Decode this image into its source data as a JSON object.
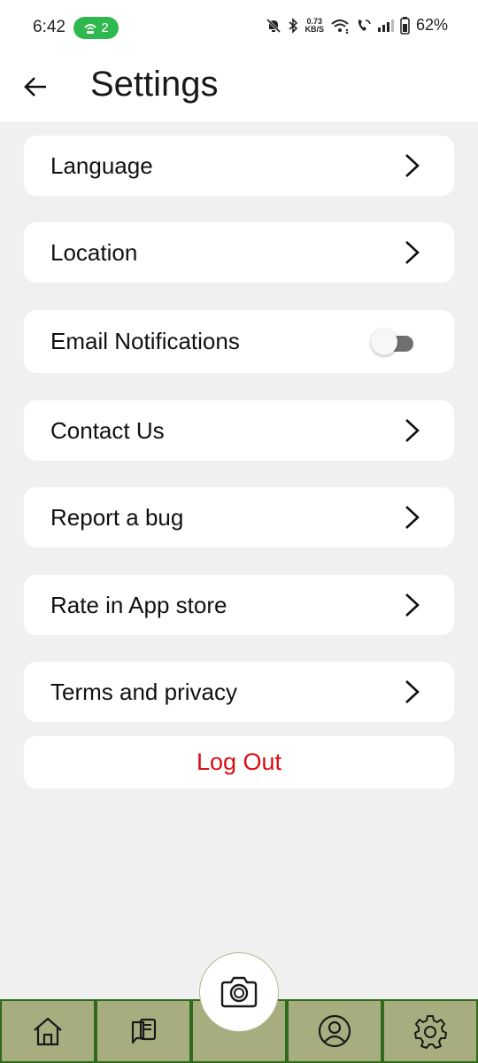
{
  "status_bar": {
    "time": "6:42",
    "hotspot_count": "2",
    "net_speed_value": "0.73",
    "net_speed_unit": "KB/S",
    "battery": "62%"
  },
  "header": {
    "title": "Settings"
  },
  "settings": {
    "items": [
      {
        "label": "Language",
        "control": "chevron"
      },
      {
        "label": "Location",
        "control": "chevron"
      },
      {
        "label": "Email Notifications",
        "control": "toggle",
        "enabled": false
      },
      {
        "label": "Contact Us",
        "control": "chevron"
      },
      {
        "label": "Report a bug",
        "control": "chevron"
      },
      {
        "label": "Rate in App store",
        "control": "chevron"
      },
      {
        "label": "Terms and privacy",
        "control": "chevron"
      }
    ],
    "logout_label": "Log Out"
  },
  "bottom_nav": {
    "tabs": [
      {
        "icon": "home-icon"
      },
      {
        "icon": "chat-book-icon"
      },
      {
        "icon": "camera-icon"
      },
      {
        "icon": "profile-icon"
      },
      {
        "icon": "gear-icon"
      }
    ]
  },
  "colors": {
    "nav_background": "#a8ad80",
    "nav_border": "#2f6a1c",
    "logout_text": "#d90d12",
    "hotspot_pill": "#2fb84f",
    "page_background": "#f0f0f0"
  }
}
